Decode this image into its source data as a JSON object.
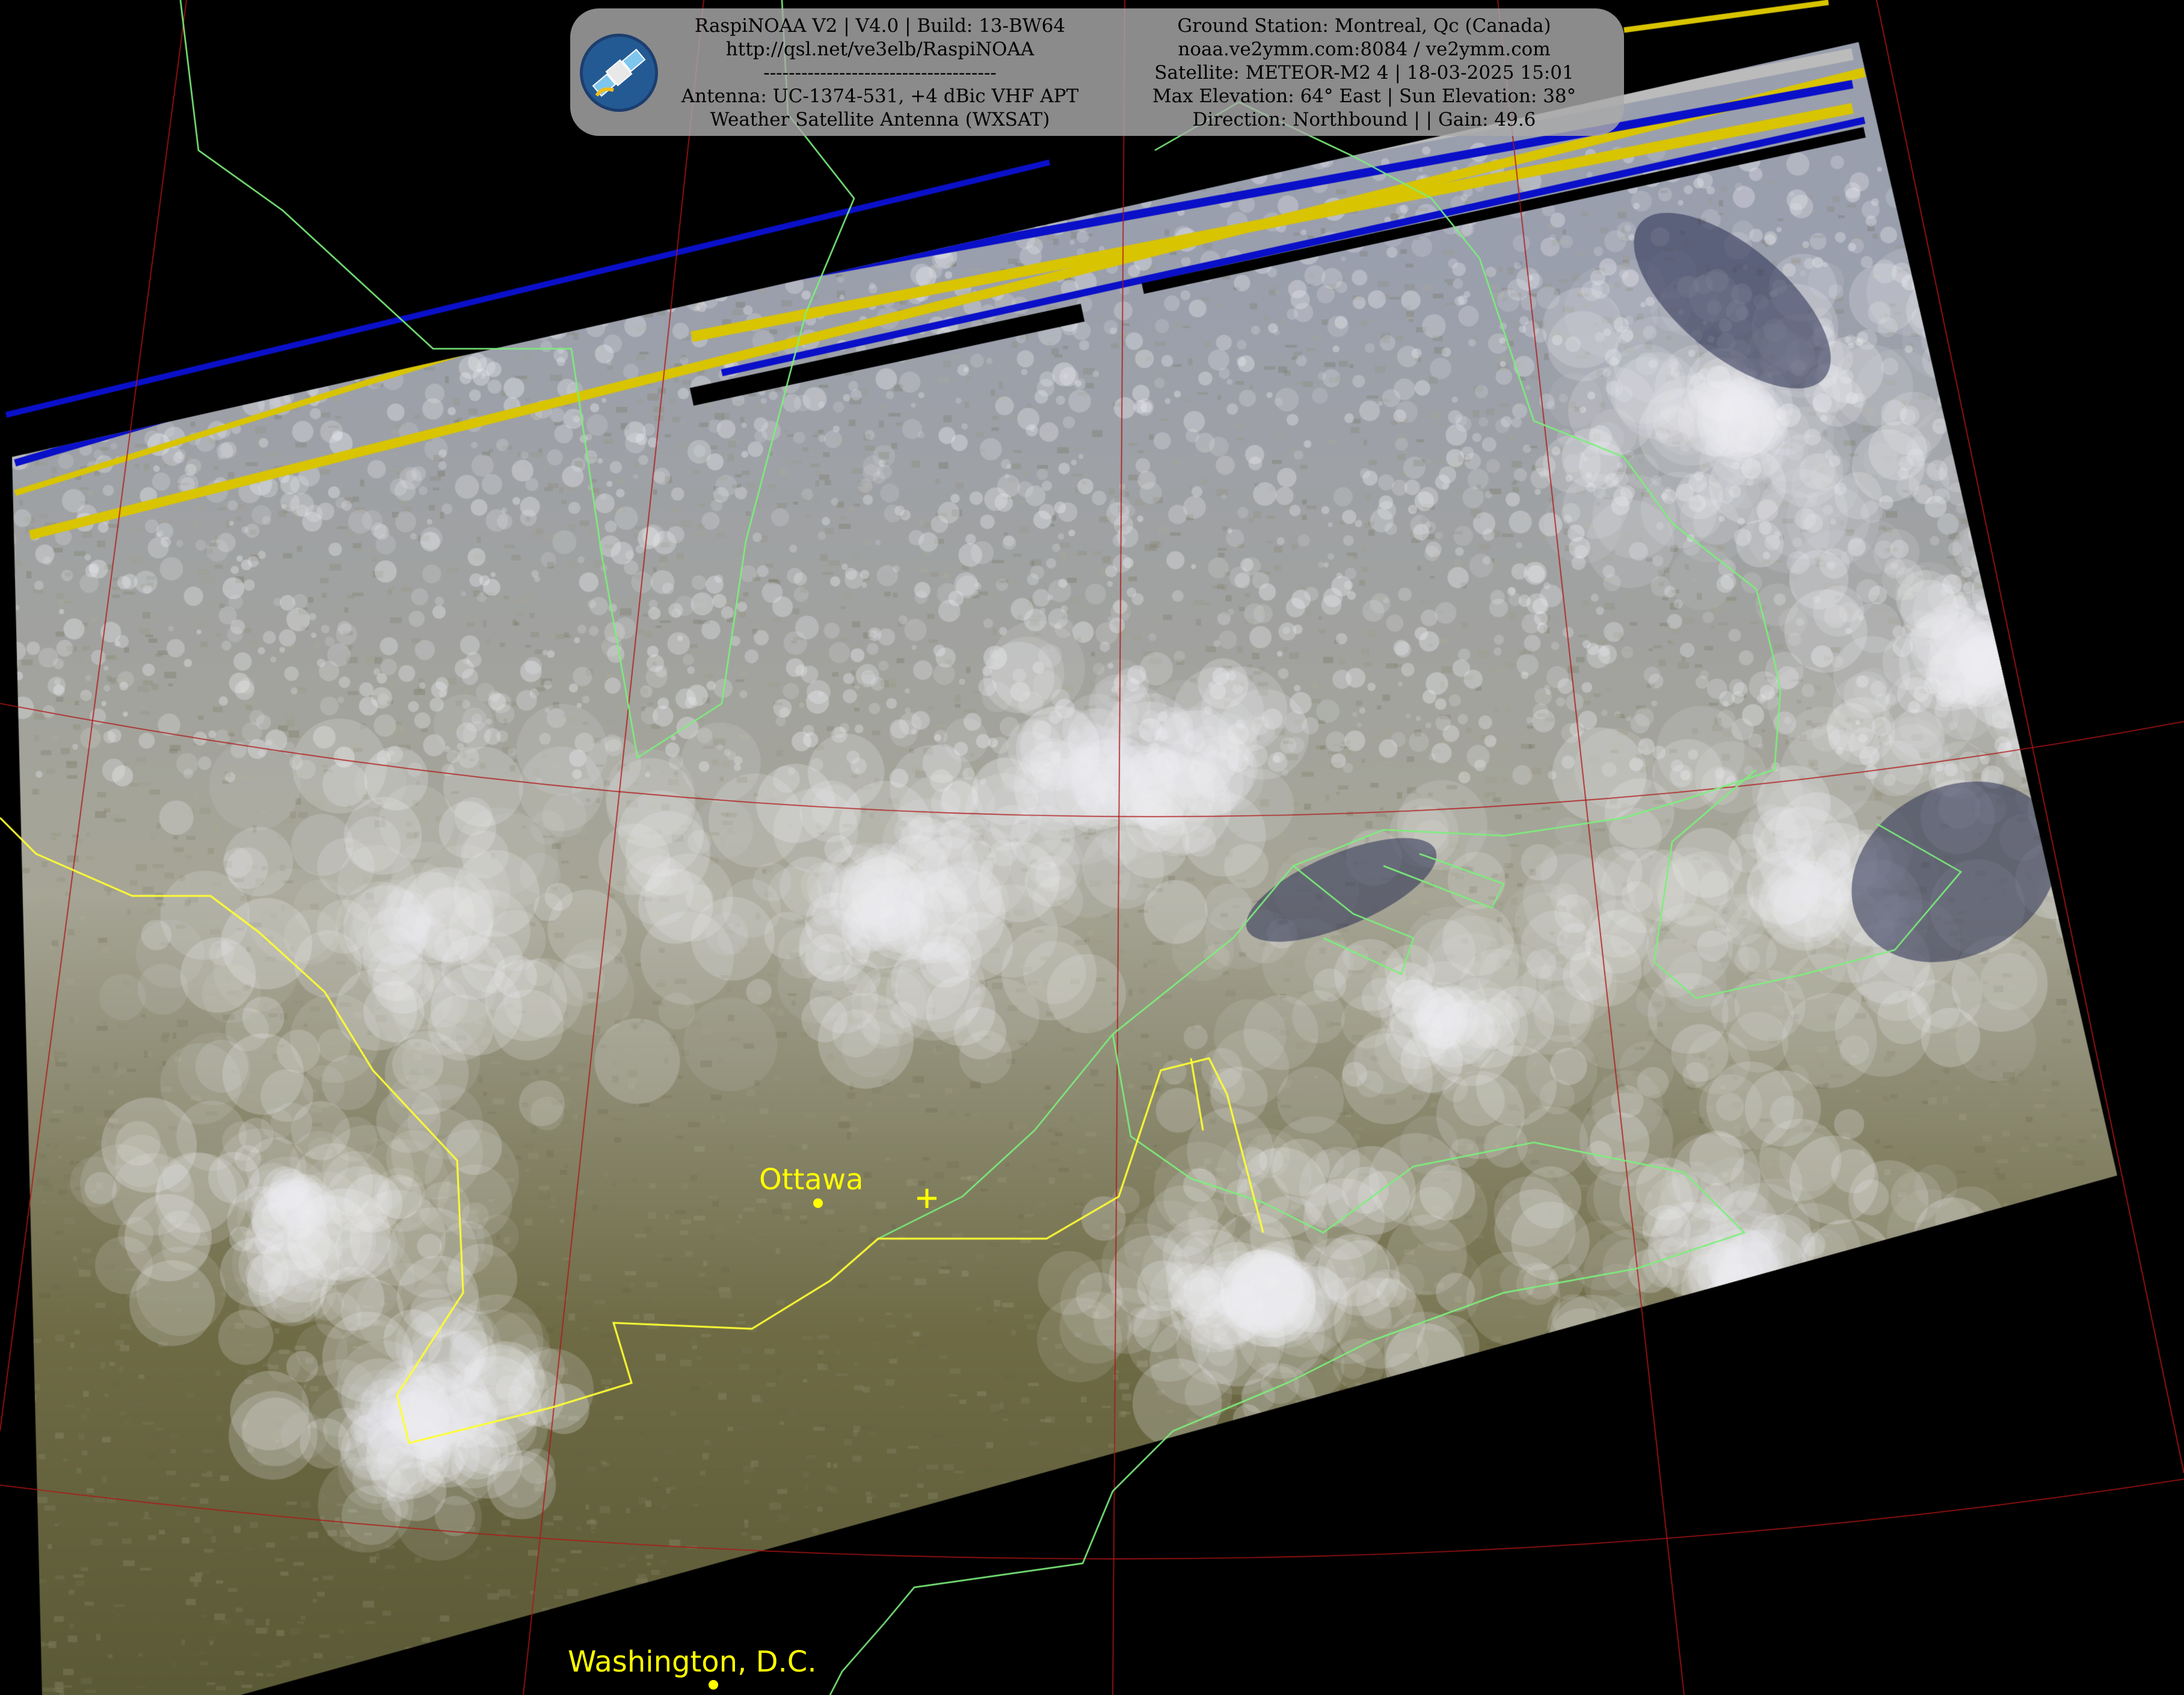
{
  "header": {
    "left_lines": [
      "RaspiNOAA V2 | V4.0 | Build: 13-BW64",
      "http://qsl.net/ve3elb/RaspiNOAA",
      "-------------------------------------",
      "Antenna: UC-1374-531, +4 dBic VHF APT",
      "Weather Satellite Antenna (WXSAT)"
    ],
    "right_lines": [
      "Ground Station: Montreal, Qc (Canada)",
      "noaa.ve2ymm.com:8084 / ve2ymm.com",
      "Satellite: METEOR-M2 4 | 18-03-2025 15:01",
      "Max Elevation: 64° East | Sun Elevation: 38°",
      "Direction: Northbound | | Gain: 49.6"
    ],
    "logo_icon": "satellite-icon"
  },
  "cities": [
    {
      "name": "Ottawa"
    },
    {
      "name": "Washington, D.C."
    }
  ],
  "station_marker_icon": "crosshair-plus-icon",
  "colors": {
    "background": "#000000",
    "coastline": "#7cf07c",
    "border": "#ffff33",
    "graticule": "#b01515",
    "city_label": "#ffff00",
    "info_box": "#aaaaaa",
    "noise_yellow": "#d8c400",
    "noise_blue": "#0a10c8"
  }
}
